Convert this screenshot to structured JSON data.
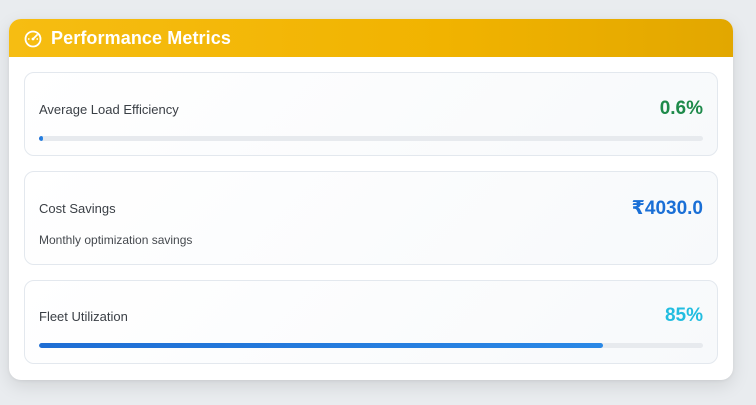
{
  "header": {
    "title": "Performance Metrics",
    "icon": "speedometer-icon",
    "background_color": "#f2b705",
    "text_color": "#ffffff"
  },
  "metrics": [
    {
      "label": "Average Load Efficiency",
      "value": "0.6%",
      "value_color": "#1e8a4a",
      "progress_percent": 0.6
    },
    {
      "label": "Cost Savings",
      "value": "₹4030.0",
      "value_color": "#1a6fd6",
      "description": "Monthly optimization savings"
    },
    {
      "label": "Fleet Utilization",
      "value": "85%",
      "value_color": "#22bde0",
      "progress_percent": 85
    }
  ]
}
